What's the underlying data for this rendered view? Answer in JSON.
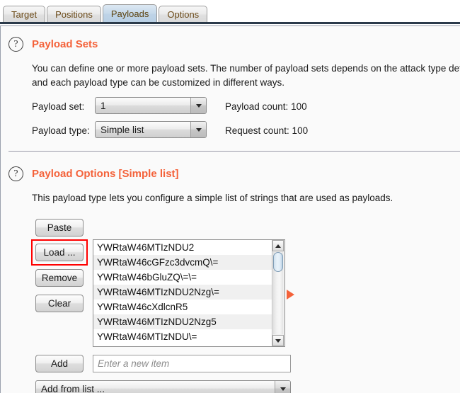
{
  "tabs": [
    {
      "label": "Target",
      "selected": false
    },
    {
      "label": "Positions",
      "selected": false
    },
    {
      "label": "Payloads",
      "selected": true
    },
    {
      "label": "Options",
      "selected": false
    }
  ],
  "payload_sets": {
    "help_icon": "question-mark-icon",
    "title": "Payload Sets",
    "description_line1": "You can define one or more payload sets. The number of payload sets depends on the attack type define",
    "description_line2": "and each payload type can be customized in different ways.",
    "payload_set_label": "Payload set:",
    "payload_set_value": "1",
    "payload_type_label": "Payload type:",
    "payload_type_value": "Simple list",
    "payload_count_label": "Payload count:  100",
    "request_count_label": "Request count: 100"
  },
  "payload_options": {
    "help_icon": "question-mark-icon",
    "title": "Payload Options [Simple list]",
    "description": "This payload type lets you configure a simple list of strings that are used as payloads.",
    "buttons": {
      "paste": "Paste",
      "load": "Load ...",
      "remove": "Remove",
      "clear": "Clear",
      "add": "Add"
    },
    "highlighted_button": "load",
    "highlight_color": "#ff0000",
    "list_items": [
      "YWRtaW46MTIzNDU2",
      "YWRtaW46cGFzc3dvcmQ\\=",
      "YWRtaW46bGluZQ\\=\\=",
      "YWRtaW46MTIzNDU2Nzg\\=",
      "YWRtaW46cXdlcnR5",
      "YWRtaW46MTIzNDU2Nzg5",
      "YWRtaW46MTIzNDU\\="
    ],
    "new_item_placeholder": "Enter a new item",
    "add_from_list_value": "Add from list ...",
    "marker_icon": "orange-right-triangle-icon"
  },
  "colors": {
    "accent": "#f4623a",
    "tab_text": "#6b4a18",
    "selected_tab_bg": "#c6d9ea",
    "panel_bg": "#fafafa",
    "highlight": "#ff0000"
  }
}
